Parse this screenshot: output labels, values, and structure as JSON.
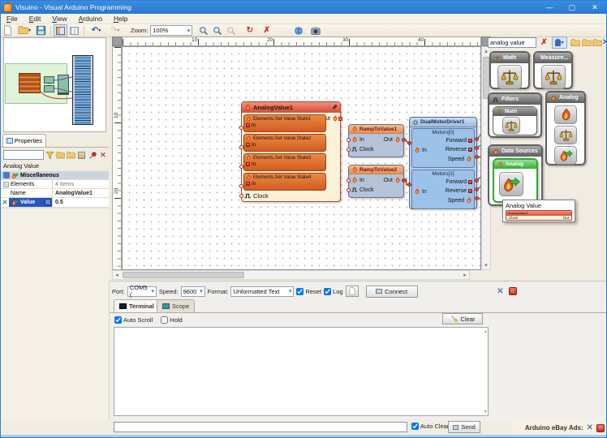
{
  "window": {
    "title": "Visuino - Visual Arduino Programming",
    "minimize": "—",
    "maximize": "▢",
    "close": "✕"
  },
  "menu": {
    "items": [
      "File",
      "Edit",
      "View",
      "Arduino",
      "Help"
    ]
  },
  "toolbar": {
    "zoom_label": "Zoom:",
    "zoom_value": "100%"
  },
  "properties": {
    "tab": "Properties",
    "object_name": "Analog Value",
    "group_label": "Miscellaneous",
    "rows": [
      {
        "name": "Elements",
        "value": "4 Items"
      },
      {
        "name": "Name",
        "value": "AnalogValue1"
      },
      {
        "name": "Value",
        "value": "0.5"
      }
    ]
  },
  "canvas": {
    "h_ruler": [
      "10",
      "20",
      "30",
      "40"
    ],
    "v_ruler": [
      "10",
      "20"
    ],
    "analog_value": {
      "title": "AnalogValue1",
      "out": "Out",
      "clock": "Clock",
      "in": "In",
      "elements": [
        "Elements.Set Value State1",
        "Elements.Set Value State2",
        "Elements.Set Value State3",
        "Elements.Set Value State4"
      ]
    },
    "ramp1": {
      "title": "RampToValue1",
      "in": "In",
      "out": "Out",
      "clock": "Clock"
    },
    "ramp2": {
      "title": "RampToValue2",
      "in": "In",
      "out": "Out",
      "clock": "Clock"
    },
    "motor": {
      "title": "DualMotorDriver1",
      "sections": [
        {
          "label": "Motors[0]",
          "in": "In",
          "forward": "Forward",
          "reverse": "Reverse",
          "speed": "Speed"
        },
        {
          "label": "Motors[1]",
          "in": "In",
          "forward": "Forward",
          "reverse": "Reverse",
          "speed": "Speed"
        }
      ]
    }
  },
  "toolbox": {
    "search_value": "analog value",
    "categories": {
      "math": "Math",
      "measure": "Measure...",
      "filters": "Filters",
      "filters_sub": "Math",
      "analog": "Analog",
      "data_sources": "Data Sources",
      "data_sources_sub": "Analog"
    },
    "tooltip": {
      "title": "Analog Value",
      "preview_title": "AnalogValue1",
      "clock": "Clock",
      "out": "Out"
    }
  },
  "serial": {
    "port_label": "Port:",
    "port_value": "COM5 (",
    "speed_label": "Speed:",
    "speed_value": "9600",
    "format_label": "Format:",
    "format_value": "Unformatted Text",
    "reset_label": "Reset",
    "log_label": "Log",
    "connect_label": "Connect",
    "tab_terminal": "Terminal",
    "tab_scope": "Scope",
    "auto_scroll_label": "Auto Scroll",
    "hold_label": "Hold",
    "clear_label": "Clear",
    "auto_clear_label": "Auto Clear",
    "send_label": "Send",
    "checks": {
      "reset": true,
      "log": true,
      "auto_scroll": true,
      "hold": false,
      "auto_clear": true
    }
  },
  "statusbar": {
    "ads_label": "Arduino eBay Ads:"
  },
  "colors": {
    "titlebar": "#2c80d8",
    "analog_component": "#e0703a",
    "motor_component": "#9cc2ea",
    "selection_green": "#44bc44",
    "wire_red": "#b02818",
    "wire_blue": "#3050c0"
  }
}
